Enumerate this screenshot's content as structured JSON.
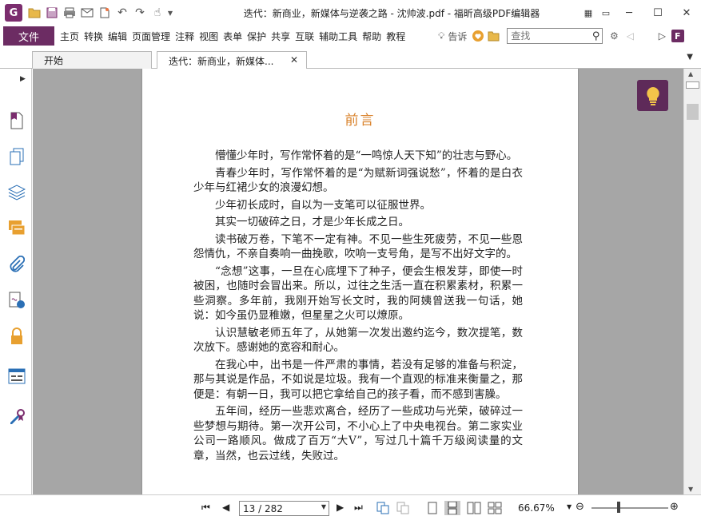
{
  "window": {
    "title": "迭代：新商业，新媒体与逆袭之路 - 沈帅波.pdf - 福昕高级PDF编辑器",
    "logo_text": "G"
  },
  "menu": {
    "file": "文件",
    "items": [
      "主页",
      "转换",
      "编辑",
      "页面管理",
      "注释",
      "视图",
      "表单",
      "保护",
      "共享",
      "互联",
      "辅助工具",
      "帮助",
      "教程"
    ],
    "tell_me": "告诉",
    "search_placeholder": "查找"
  },
  "tabs": {
    "start": "开始",
    "doc": "迭代：新商业，新媒体..."
  },
  "document": {
    "heading": "前言",
    "paragraphs": [
      "懵懂少年时，写作常怀着的是“一鸣惊人天下知”的壮志与野心。",
      "青春少年时，写作常怀着的是“为赋新词强说愁”，怀着的是白衣少年与红裙少女的浪漫幻想。",
      "少年初长成时，自以为一支笔可以征服世界。",
      "其实一切破碎之日，才是少年长成之日。",
      "读书破万卷，下笔不一定有神。不见一些生死疲劳，不见一些恩怨情仇，不亲自奏响一曲挽歌，吹响一支号角，是写不出好文字的。",
      "“念想”这事，一旦在心底埋下了种子，便会生根发芽，即使一时被困，也随时会冒出来。所以，过往之生活一直在积累素材，积累一些洞察。多年前，我刚开始写长文时，我的阿姨曾送我一句话，她说：如今虽仍显稚嫩，但星星之火可以燎原。",
      "认识慧敏老师五年了，从她第一次发出邀约迄今，数次提笔，数次放下。感谢她的宽容和耐心。",
      "在我心中，出书是一件严肃的事情，若没有足够的准备与积淀，那与其说是作品，不如说是垃圾。我有一个直观的标准来衡量之，那便是：有朝一日，我可以把它拿给自己的孩子看，而不感到害臊。",
      "五年间，经历一些悲欢离合，经历了一些成功与光荣，破碎过一些梦想与期待。第一次开公司，不小心上了中央电视台。第二家实业公司一路顺风。做成了百万“大V”，写过几十篇千万级阅读量的文章，当然，也云过线，失败过。"
    ]
  },
  "status": {
    "page_display": "13 / 282",
    "zoom": "66.67%",
    "zoom_fraction": 0.35
  },
  "colors": {
    "brand": "#6c2c63",
    "heading": "#d9822b",
    "canvas": "#a6a6a6"
  }
}
